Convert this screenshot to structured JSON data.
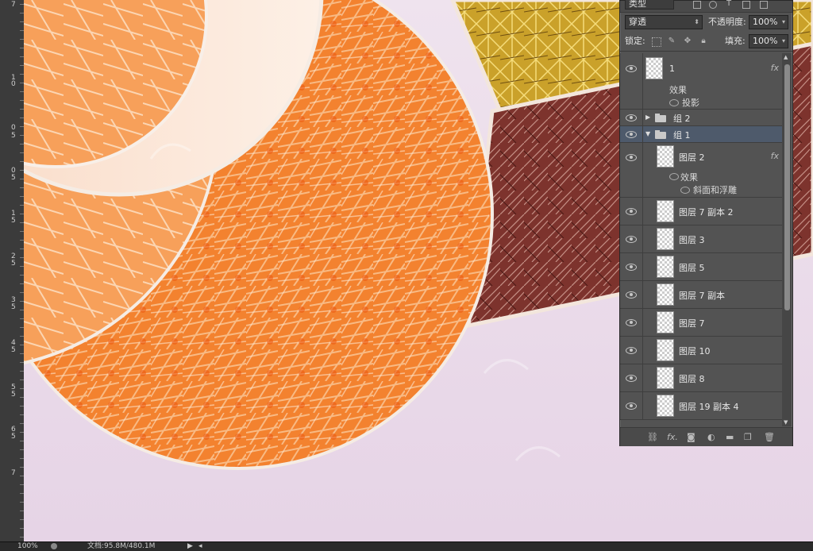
{
  "ruler": {
    "labels": [
      "7",
      "1",
      "0",
      "0",
      "5",
      "0",
      "5",
      "1",
      "5",
      "2",
      "5",
      "3",
      "5",
      "4",
      "5",
      "5",
      "5",
      "6",
      "5",
      "7"
    ]
  },
  "status": {
    "zoom": "100%",
    "doc": "文档:95.8M/480.1M"
  },
  "layers_panel": {
    "filter": "类型",
    "blend_mode": "穿透",
    "opacity_label": "不透明度:",
    "opacity_value": "100%",
    "lock_label": "锁定:",
    "fill_label": "填充:",
    "fill_value": "100%",
    "layers": [
      {
        "name": "1",
        "fx": "fx",
        "effects_label": "效果",
        "effect": "投影"
      },
      {
        "name": "组 2"
      },
      {
        "name": "组 1"
      },
      {
        "name": "图层 2",
        "fx": "fx",
        "effects_label": "效果",
        "effect": "斜面和浮雕"
      },
      {
        "name": "图层 7 副本 2"
      },
      {
        "name": "图层 3"
      },
      {
        "name": "图层 5"
      },
      {
        "name": "图层 7 副本"
      },
      {
        "name": "图层 7"
      },
      {
        "name": "图层 10"
      },
      {
        "name": "图层 8"
      },
      {
        "name": "图层 19 副本 4"
      }
    ]
  },
  "icons": [
    "eye-icon",
    "folder-icon",
    "link-icon",
    "fx-icon",
    "mask-icon",
    "adjustment-icon",
    "new-group-icon",
    "new-layer-icon",
    "trash-icon",
    "lock-icon"
  ],
  "colors": {
    "orange": "#f27a2e",
    "peach": "#fbe3d3",
    "lavender": "#e9dbe8",
    "gold": "#d9a21a",
    "maroon": "#8a3b34",
    "panel": "#535353"
  }
}
